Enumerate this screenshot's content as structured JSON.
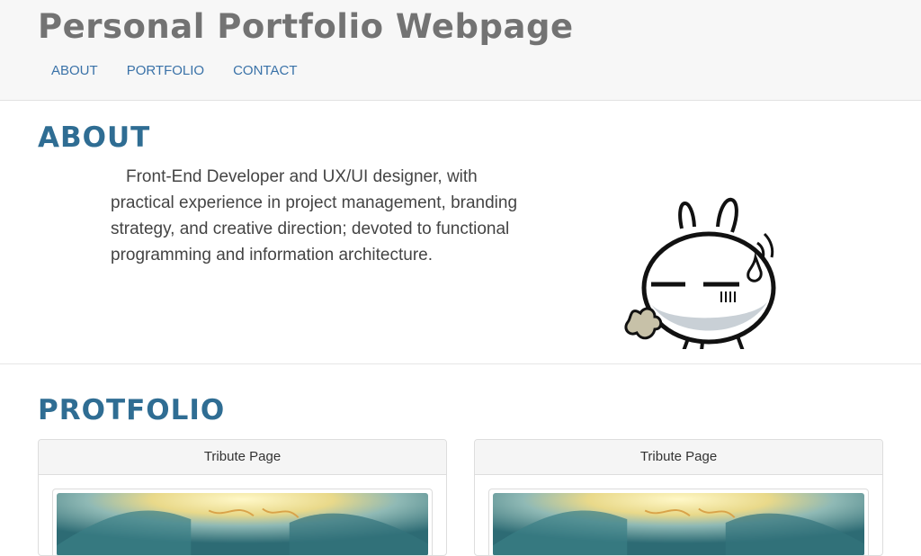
{
  "header": {
    "title": "Personal Portfolio Webpage",
    "nav": [
      {
        "label": "ABOUT"
      },
      {
        "label": "PORTFOLIO"
      },
      {
        "label": "CONTACT"
      }
    ]
  },
  "about": {
    "heading": "ABOUT",
    "text": "Front-End Developer and UX/UI designer, with practical experience in project management, branding strategy, and creative direction; devoted to functional programming and information architecture.",
    "illustration": "bunny-character-icon"
  },
  "portfolio": {
    "heading": "PROTFOLIO",
    "cards": [
      {
        "title": "Tribute Page",
        "thumbnail": "underwater-light-image"
      },
      {
        "title": "Tribute Page",
        "thumbnail": "underwater-light-image"
      }
    ]
  },
  "colors": {
    "heading": "#2f6d93",
    "title": "#737373",
    "nav_link": "#3a72a8",
    "header_bg": "#f7f7f7"
  }
}
